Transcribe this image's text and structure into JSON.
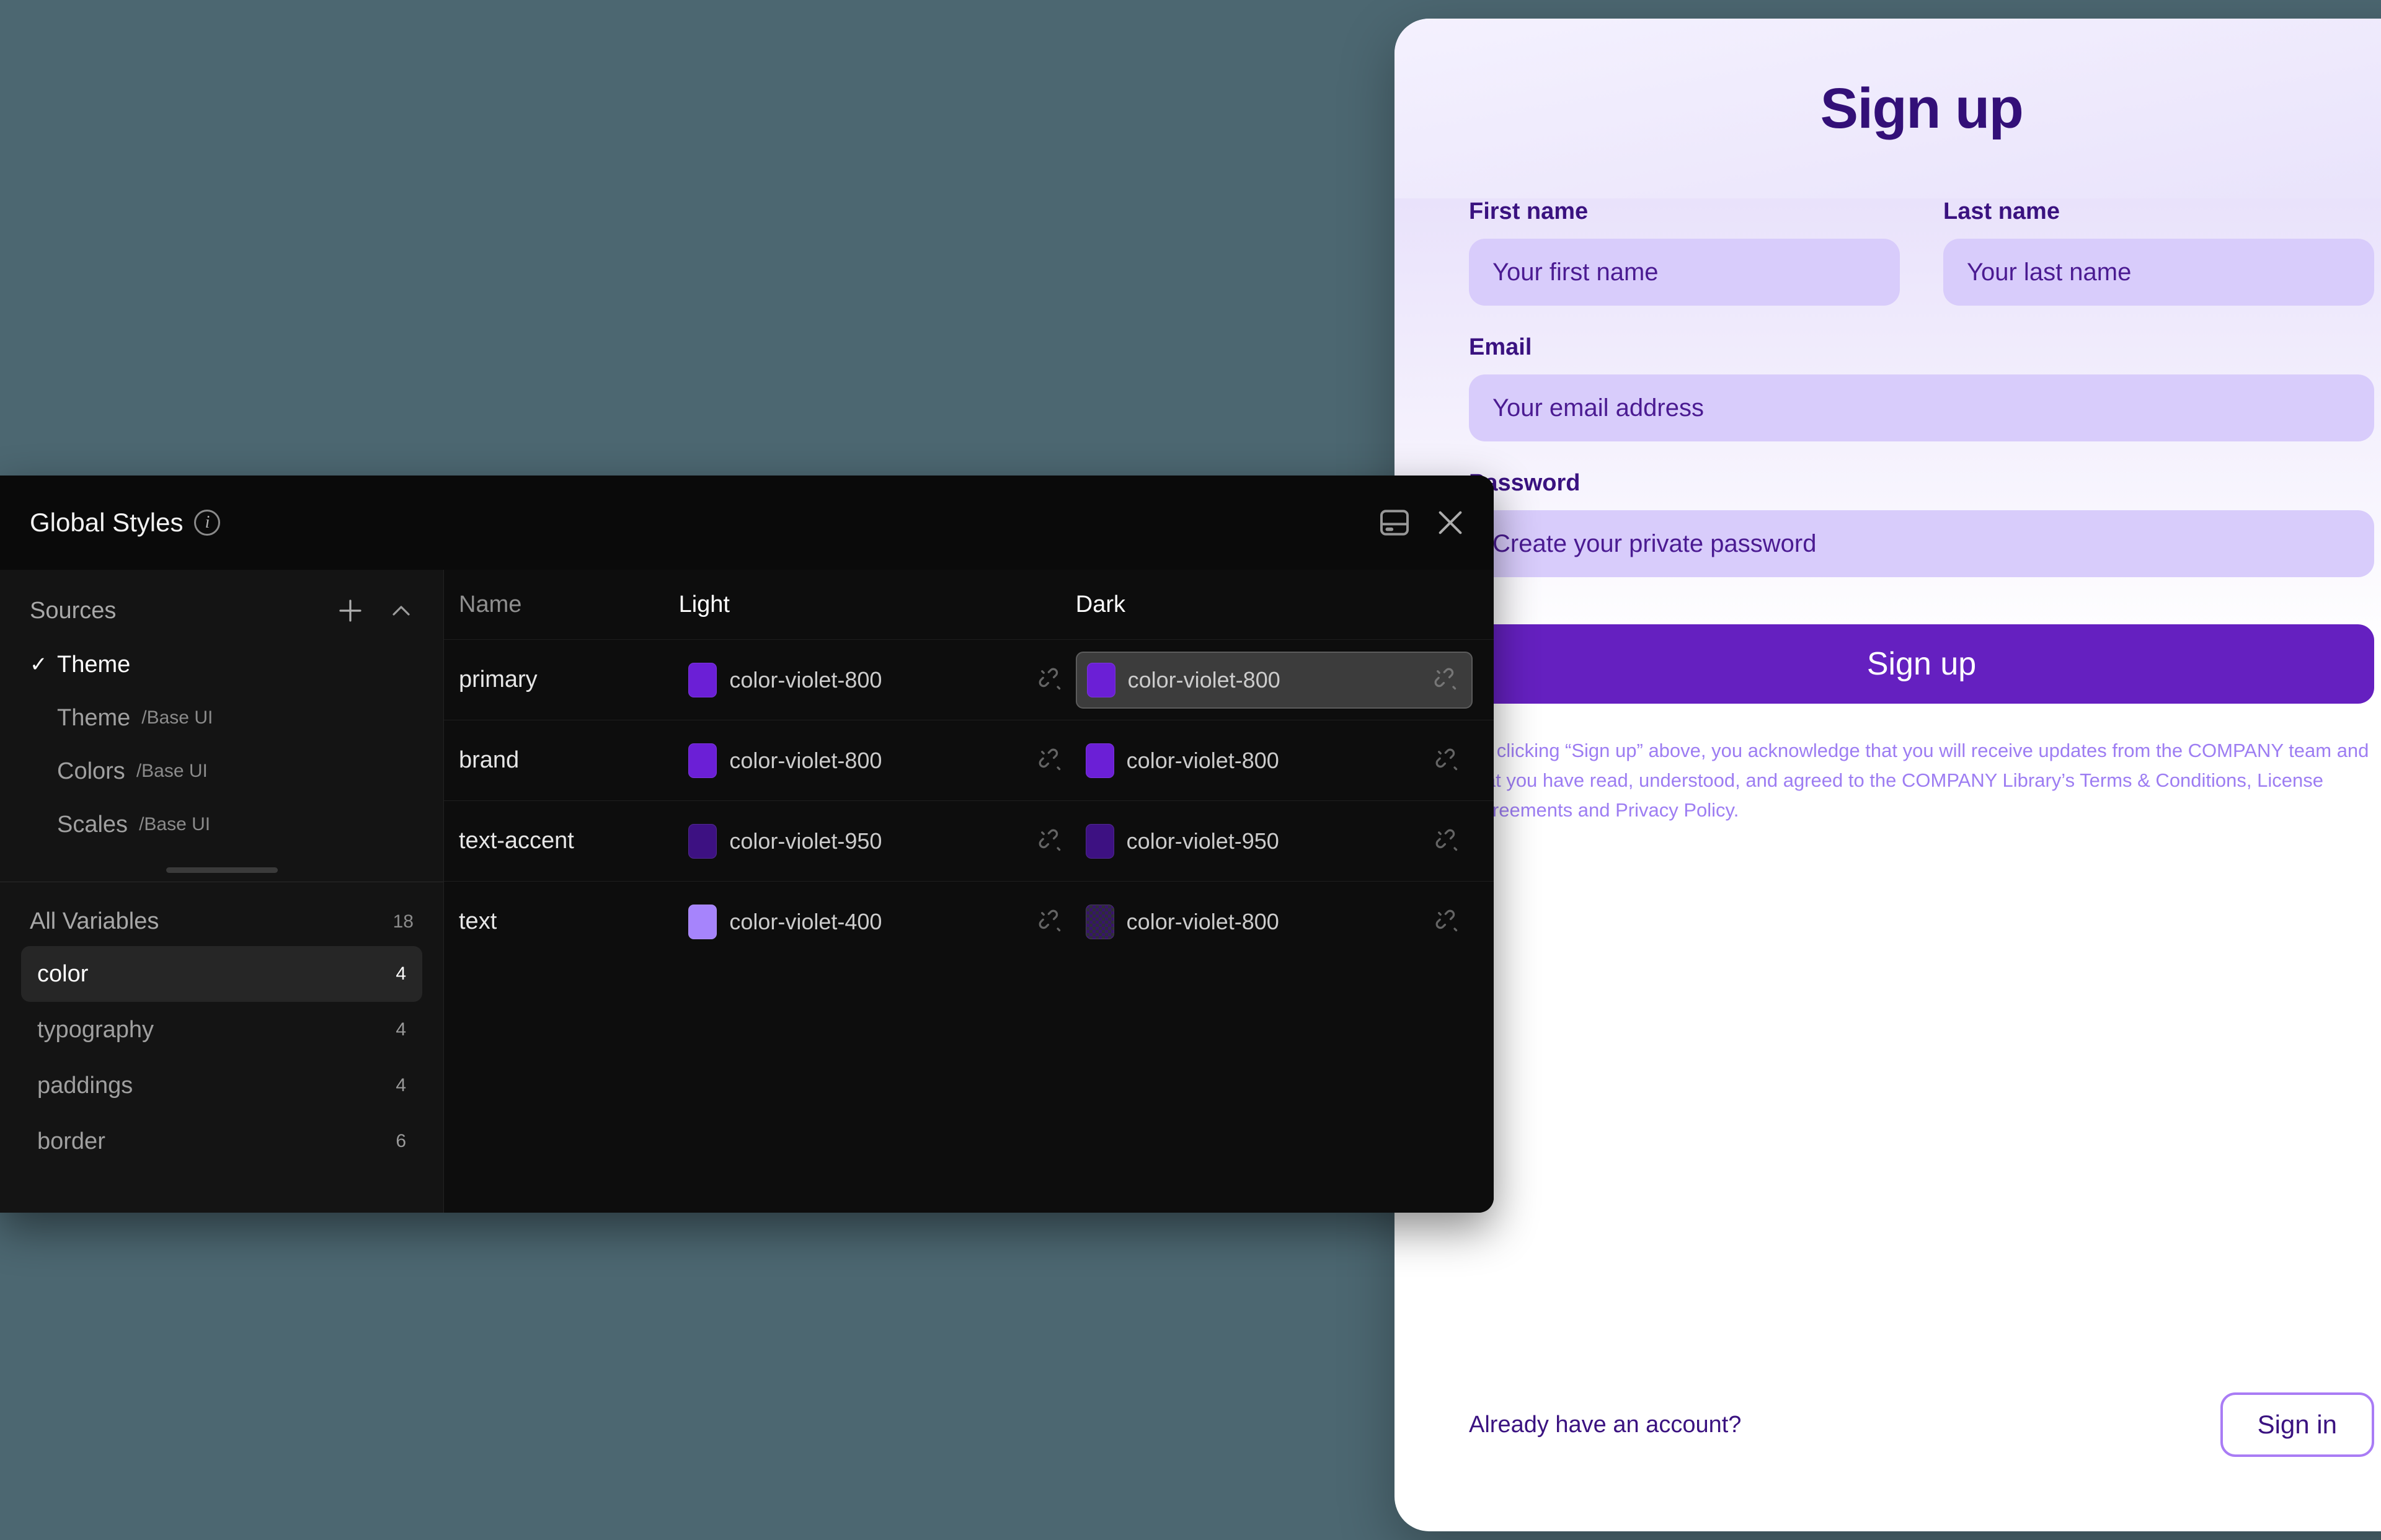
{
  "background_color": "#4c6771",
  "signup": {
    "title": "Sign up",
    "first_name": {
      "label": "First name",
      "placeholder": "Your first name"
    },
    "last_name": {
      "label": "Last name",
      "placeholder": "Your last name"
    },
    "email": {
      "label": "Email",
      "placeholder": "Your email address"
    },
    "password": {
      "label": "Password",
      "placeholder": "Create your private password"
    },
    "submit_label": "Sign up",
    "legal_text": "By clicking “Sign up” above, you acknowledge that you will receive updates from the COMPANY team and that you have read, understood, and agreed to the COMPANY Library’s Terms & Conditions, License Agreements and Privacy Policy.",
    "signin_question": "Already have an account?",
    "signin_label": "Sign in",
    "accent_color": "#6520c0",
    "title_color": "#331078",
    "input_bg": "#d8ccfb",
    "legal_color": "#9d7df2"
  },
  "panel": {
    "title": "Global Styles",
    "info_icon": "info-icon",
    "save_icon": "save-icon",
    "close_icon": "close-icon",
    "sources": {
      "label": "Sources",
      "add_icon": "plus-icon",
      "collapse_icon": "chevron-up-icon",
      "items": [
        {
          "name": "Theme",
          "path": "",
          "checked": true
        },
        {
          "name": "Theme",
          "path": "/Base UI",
          "checked": false
        },
        {
          "name": "Colors",
          "path": "/Base UI",
          "checked": false
        },
        {
          "name": "Scales",
          "path": "/Base UI",
          "checked": false
        }
      ]
    },
    "all_variables": {
      "label": "All Variables",
      "count": "18",
      "groups": [
        {
          "name": "color",
          "count": "4",
          "active": true
        },
        {
          "name": "typography",
          "count": "4",
          "active": false
        },
        {
          "name": "paddings",
          "count": "4",
          "active": false
        },
        {
          "name": "border",
          "count": "6",
          "active": false
        }
      ]
    },
    "table": {
      "columns": [
        "Name",
        "Light",
        "Dark"
      ],
      "rows": [
        {
          "name": "primary",
          "light": {
            "value": "color-violet-800",
            "color": "#6b1fd6",
            "checker": false,
            "selected": false
          },
          "dark": {
            "value": "color-violet-800",
            "color": "#6b1fd6",
            "checker": false,
            "selected": true
          }
        },
        {
          "name": "brand",
          "light": {
            "value": "color-violet-800",
            "color": "#6b1fd6",
            "checker": false,
            "selected": false
          },
          "dark": {
            "value": "color-violet-800",
            "color": "#6b1fd6",
            "checker": false,
            "selected": false
          }
        },
        {
          "name": "text-accent",
          "light": {
            "value": "color-violet-950",
            "color": "#3d1182",
            "checker": false,
            "selected": false
          },
          "dark": {
            "value": "color-violet-950",
            "color": "#3d1182",
            "checker": false,
            "selected": false
          }
        },
        {
          "name": "text",
          "light": {
            "value": "color-violet-400",
            "color": "#a684fc",
            "checker": false,
            "selected": false
          },
          "dark": {
            "value": "color-violet-800",
            "color": "rgba(107,31,214,0.45)",
            "checker": true,
            "selected": false
          }
        }
      ],
      "unlink_icon": "unlink-icon"
    }
  }
}
